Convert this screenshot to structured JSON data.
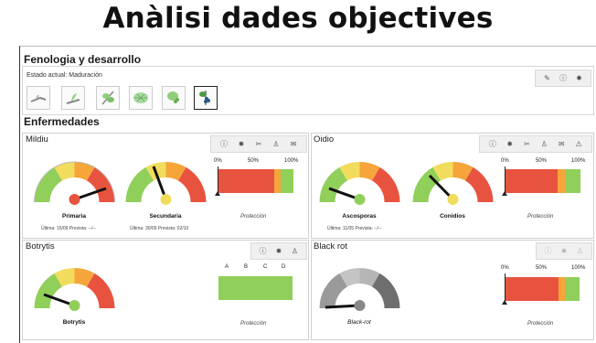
{
  "slide_title": "Anàlisi dades objectives",
  "fenologia": {
    "title": "Fenologia y desarrollo",
    "state": "Estado actual: Maduración",
    "toolbar_icons": [
      "pencil-icon",
      "info-icon",
      "gear-icon"
    ]
  },
  "enfermedades": {
    "title": "Enfermedades"
  },
  "mildiu": {
    "title": "Mildiu",
    "gauges": [
      {
        "label": "Primaria",
        "sub": "Última: 15/09 Prevista: --/--"
      },
      {
        "label": "Secundaria",
        "sub": "Última: 30/09 Prevista: 02/10"
      }
    ],
    "percent_labels": [
      "0%",
      "50%",
      "100%"
    ],
    "protection_label": "Protección",
    "protection_levels": {
      "red": 0.74,
      "orange": 0.09,
      "green": 0.17
    }
  },
  "oidio": {
    "title": "Oidio",
    "gauges": [
      {
        "label": "Ascosporas",
        "sub": "Última: 11/05 Prevista: --/--"
      },
      {
        "label": "Conidios",
        "sub": ""
      }
    ],
    "percent_labels": [
      "0%",
      "50%",
      "100%"
    ],
    "protection_label": "Protección",
    "protection_levels": {
      "red": 0.7,
      "orange": 0.1,
      "green": 0.2
    }
  },
  "botrytis": {
    "title": "Botrytis",
    "gauges": [
      {
        "label": "Botrytis",
        "sub": ""
      }
    ],
    "abcd_labels": [
      "A",
      "B",
      "C",
      "D"
    ],
    "protection_label": "Protección"
  },
  "blackrot": {
    "title": "Black rot",
    "gauges": [
      {
        "label": "Black-rot",
        "sub": ""
      }
    ],
    "percent_labels": [
      "0%",
      "50%",
      "100%"
    ],
    "protection_label": "Protección",
    "protection_levels": {
      "red": 0.72,
      "orange": 0.1,
      "green": 0.18
    }
  },
  "colors": {
    "red": "#e8533f",
    "orange": "#f5a53a",
    "yellow": "#f2dc5d",
    "green": "#90cf5a",
    "grey_dark": "#6e6e6e",
    "grey_light": "#b5b5b5"
  }
}
